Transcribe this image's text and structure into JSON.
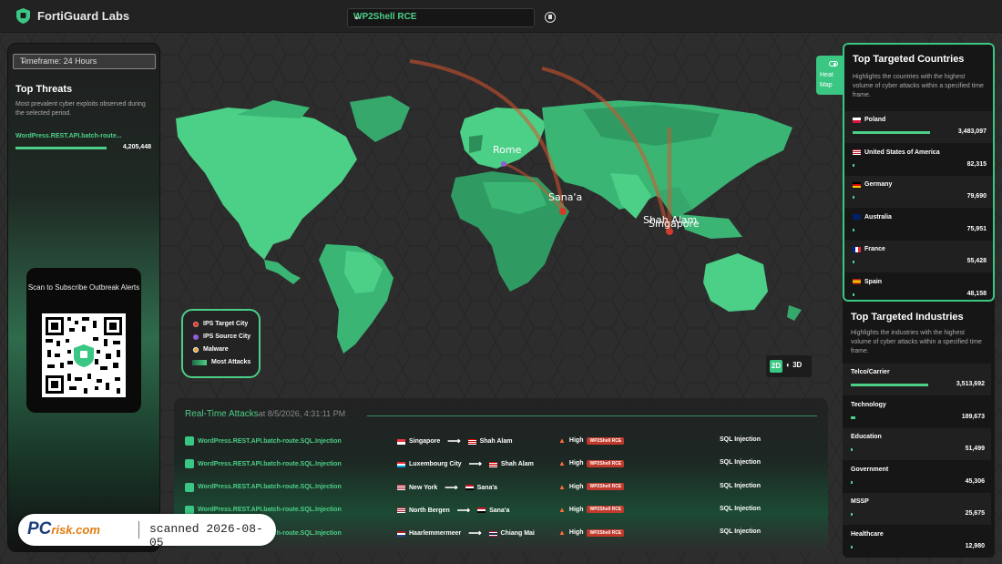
{
  "app": {
    "title": "FortiGuard Labs"
  },
  "threat_selector": {
    "value": "WP2Shell RCE"
  },
  "left_panel": {
    "timeframe": "Timeframe: 24 Hours",
    "title": "Top Threats",
    "description": "Most prevalent cyber exploits observed during the selected period.",
    "threats": [
      {
        "name": "WordPress.REST.API.batch-route...",
        "count": "4,205,448"
      }
    ],
    "qr_title": "Scan to Subscribe Outbreak Alerts"
  },
  "legend": {
    "items": [
      {
        "label": "IPS Target City",
        "color": "#d23b2b"
      },
      {
        "label": "IPS Source City",
        "color": "#8e5fd6"
      },
      {
        "label": "Malware",
        "color": "#e8a02a"
      },
      {
        "label": "Most Attacks"
      }
    ]
  },
  "map": {
    "heatmap_label": "Heat Map",
    "view_2d": "2D",
    "view_3d": "3D",
    "cities": [
      "Rome",
      "Sana'a",
      "Shah Alam",
      "Singapore"
    ]
  },
  "countries": {
    "title": "Top Targeted Countries",
    "description": "Highlights the countries with the highest volume of cyber attacks within a specified time frame.",
    "items": [
      {
        "name": "Poland",
        "count": "3,483,097",
        "pct": 1.0
      },
      {
        "name": "United States of America",
        "count": "82,315",
        "pct": 0.024
      },
      {
        "name": "Germany",
        "count": "79,690",
        "pct": 0.023
      },
      {
        "name": "Australia",
        "count": "75,951",
        "pct": 0.022
      },
      {
        "name": "France",
        "count": "55,428",
        "pct": 0.016
      },
      {
        "name": "Spain",
        "count": "48,158",
        "pct": 0.014
      }
    ]
  },
  "industries": {
    "title": "Top Targeted Industries",
    "description": "Highlights the industries with the highest volume of cyber attacks within a specified time frame.",
    "items": [
      {
        "name": "Telco/Carrier",
        "count": "3,513,692",
        "pct": 1.0
      },
      {
        "name": "Technology",
        "count": "189,673",
        "pct": 0.054
      },
      {
        "name": "Education",
        "count": "51,499",
        "pct": 0.015
      },
      {
        "name": "Government",
        "count": "45,306",
        "pct": 0.013
      },
      {
        "name": "MSSP",
        "count": "25,675",
        "pct": 0.007
      },
      {
        "name": "Healthcare",
        "count": "12,980",
        "pct": 0.004
      }
    ]
  },
  "realtime": {
    "title": "Real-Time Attacks",
    "timestamp": "at 8/5/2026, 4:31:11 PM",
    "rows": [
      {
        "threat": "WordPress.REST.API.batch-route.SQL.Injection",
        "source": "Singapore",
        "target": "Shah Alam",
        "severity": "High",
        "tag": "WP2Shell RCE",
        "type": "SQL Injection"
      },
      {
        "threat": "WordPress.REST.API.batch-route.SQL.Injection",
        "source": "Luxembourg City",
        "target": "Shah Alam",
        "severity": "High",
        "tag": "WP2Shell RCE",
        "type": "SQL Injection"
      },
      {
        "threat": "WordPress.REST.API.batch-route.SQL.Injection",
        "source": "New York",
        "target": "Sana'a",
        "severity": "High",
        "tag": "WP2Shell RCE",
        "type": "SQL Injection"
      },
      {
        "threat": "WordPress.REST.API.batch-route.SQL.Injection",
        "source": "North Bergen",
        "target": "Sana'a",
        "severity": "High",
        "tag": "WP2Shell RCE",
        "type": "SQL Injection"
      },
      {
        "threat": "WordPress.REST.API.batch-route.SQL.Injection",
        "source": "Haarlemmermeer",
        "target": "Chiang Mai",
        "severity": "High",
        "tag": "WP2Shell RCE",
        "type": "SQL Injection"
      }
    ]
  },
  "watermark": {
    "logo_pc": "PC",
    "logo_risk": "risk.com",
    "text": "scanned 2026-08-05"
  }
}
